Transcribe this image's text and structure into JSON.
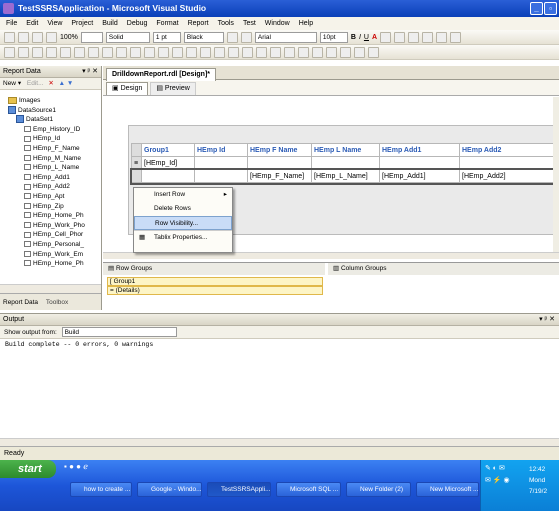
{
  "window": {
    "title": "TestSSRSApplication - Microsoft Visual Studio"
  },
  "menu": [
    "File",
    "Edit",
    "View",
    "Project",
    "Build",
    "Debug",
    "Format",
    "Report",
    "Tools",
    "Test",
    "Window",
    "Help"
  ],
  "toolbar1": {
    "zoom": "100%",
    "border_style": "Solid",
    "border_width": "1 pt",
    "border_color": "Black",
    "font_name": "Arial",
    "font_size": "10pt",
    "bold": "B",
    "italic": "I",
    "underline": "U",
    "font_color": "A"
  },
  "report_data": {
    "title": "Report Data",
    "new_label": "New",
    "edit_label": "Edit...",
    "tab_report_data": "Report Data",
    "tab_toolbox": "Toolbox",
    "tree": [
      {
        "label": "Images",
        "kind": "folder",
        "indent": 1
      },
      {
        "label": "DataSource1",
        "kind": "datasource",
        "indent": 1
      },
      {
        "label": "DataSet1",
        "kind": "dataset",
        "indent": 2
      },
      {
        "label": "Emp_History_ID",
        "kind": "field",
        "indent": 3
      },
      {
        "label": "HEmp_Id",
        "kind": "field",
        "indent": 3
      },
      {
        "label": "HEmp_F_Name",
        "kind": "field",
        "indent": 3
      },
      {
        "label": "HEmp_M_Name",
        "kind": "field",
        "indent": 3
      },
      {
        "label": "HEmp_L_Name",
        "kind": "field",
        "indent": 3
      },
      {
        "label": "HEmp_Add1",
        "kind": "field",
        "indent": 3
      },
      {
        "label": "HEmp_Add2",
        "kind": "field",
        "indent": 3
      },
      {
        "label": "HEmp_Apt",
        "kind": "field",
        "indent": 3
      },
      {
        "label": "HEmp_Zip",
        "kind": "field",
        "indent": 3
      },
      {
        "label": "HEmp_Home_Ph",
        "kind": "field",
        "indent": 3
      },
      {
        "label": "HEmp_Work_Pho",
        "kind": "field",
        "indent": 3
      },
      {
        "label": "HEmp_Cell_Phor",
        "kind": "field",
        "indent": 3
      },
      {
        "label": "HEmp_Personal_",
        "kind": "field",
        "indent": 3
      },
      {
        "label": "HEmp_Work_Em",
        "kind": "field",
        "indent": 3
      },
      {
        "label": "HEmp_Home_Ph",
        "kind": "field",
        "indent": 3
      }
    ]
  },
  "document": {
    "tab": "DrilldownReport.rdl [Design]*",
    "design_tab": "Design",
    "preview_tab": "Preview"
  },
  "tablix": {
    "headers": [
      "Group1",
      "HEmp Id",
      "HEmp F Name",
      "HEmp L Name",
      "HEmp Add1",
      "HEmp Add2"
    ],
    "group_row": [
      "[HEmp_Id]"
    ],
    "detail_row": [
      "[HEmp_F_Name]",
      "[HEmp_L_Name]",
      "[HEmp_Add1]",
      "[HEmp_Add2]"
    ]
  },
  "context_menu": [
    "Insert Row",
    "Delete Rows",
    "Row Visibility...",
    "Tablix Properties..."
  ],
  "groups": {
    "row_groups_label": "Row Groups",
    "column_groups_label": "Column Groups",
    "row_items": [
      "[ Group1",
      "= (Details)"
    ]
  },
  "output": {
    "title": "Output",
    "show_from_label": "Show output from:",
    "show_from_value": "Build",
    "text": "Build complete -- 0 errors, 0 warnings"
  },
  "status": {
    "text": "Ready"
  },
  "taskbar": {
    "start": "start",
    "tasks": [
      "how to create ...",
      "Google - Windo...",
      "TestSSRSAppli...",
      "Microsoft SQL ...",
      "New Folder (2)",
      "New Microsoft ..."
    ],
    "clock_time": "12:42",
    "clock_day": "Mond",
    "clock_date": "7/19/2"
  },
  "colors": {
    "title_bar": "#0a3fb8",
    "taskbar": "#245edb",
    "start": "#2d8a2d",
    "menu_highlight": "#c9dcf7",
    "group_header": "#2b5bb5"
  }
}
